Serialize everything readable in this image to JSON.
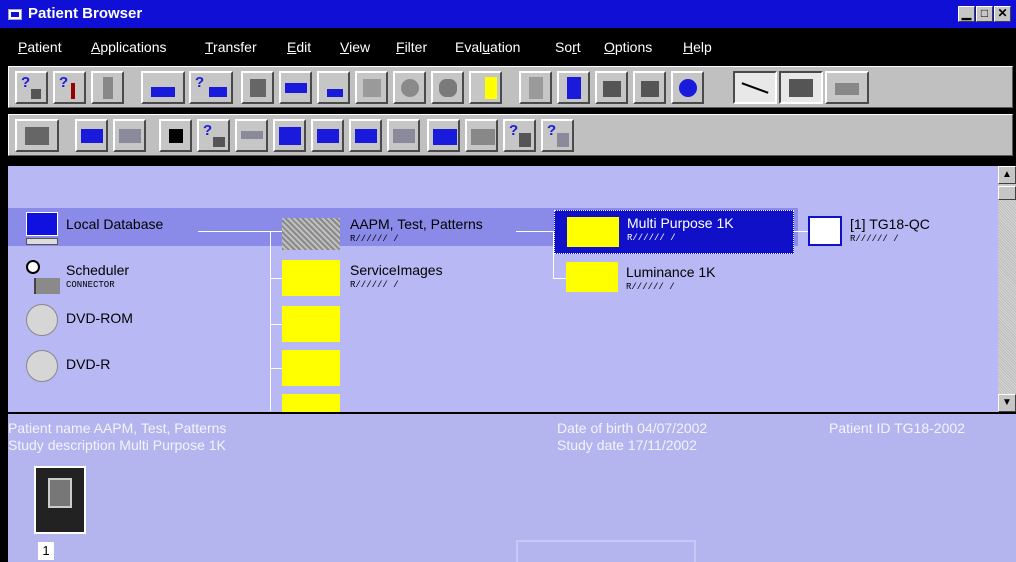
{
  "window": {
    "title": "Patient Browser",
    "minimize": "▁",
    "maximize": "□",
    "close": "✕"
  },
  "menu": [
    {
      "pre": "",
      "u": "P",
      "post": "atient"
    },
    {
      "pre": "",
      "u": "A",
      "post": "pplications"
    },
    {
      "pre": "",
      "u": "T",
      "post": "ransfer"
    },
    {
      "pre": "",
      "u": "E",
      "post": "dit"
    },
    {
      "pre": "",
      "u": "V",
      "post": "iew"
    },
    {
      "pre": "",
      "u": "F",
      "post": "ilter"
    },
    {
      "pre": "Eval",
      "u": "u",
      "post": "ation"
    },
    {
      "pre": "So",
      "u": "r",
      "post": "t"
    },
    {
      "pre": "",
      "u": "O",
      "post": "ptions"
    },
    {
      "pre": "",
      "u": "H",
      "post": "elp"
    }
  ],
  "tree": {
    "sources": [
      {
        "label": "Local Database",
        "sub": "",
        "icon": "computer-icon"
      },
      {
        "label": "Scheduler",
        "sub": "CONNECTOR",
        "icon": "clock-icon"
      },
      {
        "label": "DVD-ROM",
        "sub": "",
        "icon": "disc-icon"
      },
      {
        "label": "DVD-R",
        "sub": "",
        "icon": "disc-icon"
      }
    ],
    "patients": [
      {
        "label": "AAPM, Test, Patterns",
        "sub": "R////// /"
      },
      {
        "label": "ServiceImages",
        "sub": "R////// /"
      },
      {
        "label": "",
        "sub": ""
      },
      {
        "label": "",
        "sub": ""
      },
      {
        "label": "",
        "sub": ""
      }
    ],
    "studies": [
      {
        "label": "Multi Purpose 1K",
        "sub": "R////// /"
      },
      {
        "label": "Luminance 1K",
        "sub": "R////// /"
      }
    ],
    "series": [
      {
        "label": "[1] TG18-QC",
        "sub": "R////// /"
      }
    ]
  },
  "info": {
    "patient_name": "Patient name AAPM, Test, Patterns",
    "study_description": "Study description Multi Purpose 1K",
    "date_of_birth": "Date of birth 04/07/2002",
    "study_date": "Study date 17/11/2002",
    "patient_id": "Patient ID TG18-2002",
    "thumbnail_number": "1"
  },
  "colors": {
    "titlebar": "#0f0fd6",
    "tree_bg": "#b8b8f4",
    "selected_row": "#8a8ae8",
    "selected_study": "#1010c8",
    "folder": "#ffff00"
  }
}
